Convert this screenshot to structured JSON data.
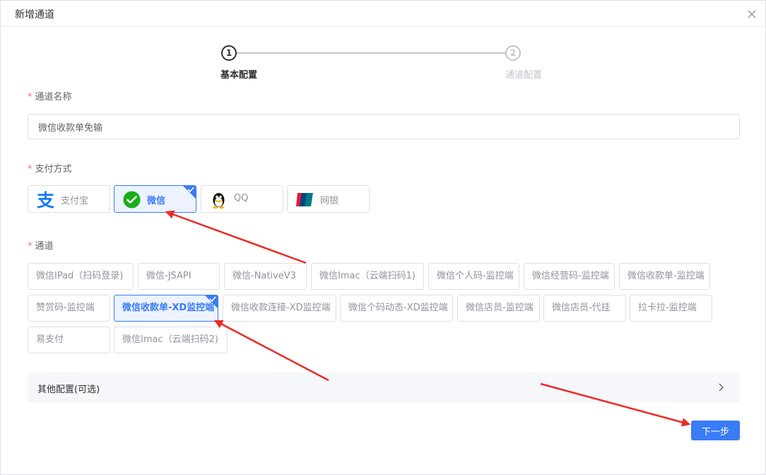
{
  "dialog": {
    "title": "新增通道"
  },
  "steps": [
    {
      "number": "1",
      "title": "基本配置"
    },
    {
      "number": "2",
      "title": "通道配置"
    }
  ],
  "form": {
    "name_label": "通道名称",
    "name_value": "微信收款单免输",
    "pay_label": "支付方式",
    "channel_label": "通道"
  },
  "pay_methods": [
    {
      "label": "支付宝",
      "icon": "alipay-icon"
    },
    {
      "label": "微信",
      "icon": "wechat-icon",
      "selected": true
    },
    {
      "label": "QQ",
      "icon": "qq-icon"
    },
    {
      "label": "网银",
      "icon": "unionpay-icon"
    }
  ],
  "channels": [
    {
      "label": "微信IPad（扫码登录)"
    },
    {
      "label": "微信-JSAPI"
    },
    {
      "label": "微信-NativeV3"
    },
    {
      "label": "微信Imac（云端扫码1)"
    },
    {
      "label": "微信个人码-监控端"
    },
    {
      "label": "微信经营码-监控端"
    },
    {
      "label": "微信收款单-监控端"
    },
    {
      "label": "赞赏码-监控端"
    },
    {
      "label": "微信收款单-XD监控端",
      "selected": true
    },
    {
      "label": "微信收款连接-XD监控端"
    },
    {
      "label": "微信个码动态-XD监控端"
    },
    {
      "label": "微信店员-监控端"
    },
    {
      "label": "微信店员-代挂"
    },
    {
      "label": "拉卡拉-监控端"
    },
    {
      "label": "易支付"
    },
    {
      "label": "微信Imac（云端扫码2)"
    }
  ],
  "other_config": {
    "label": "其他配置(可选)"
  },
  "next_label": "下一步",
  "colors": {
    "primary": "#3a7bf6",
    "required": "#f56c6c",
    "annotation": "#ee2a24"
  }
}
